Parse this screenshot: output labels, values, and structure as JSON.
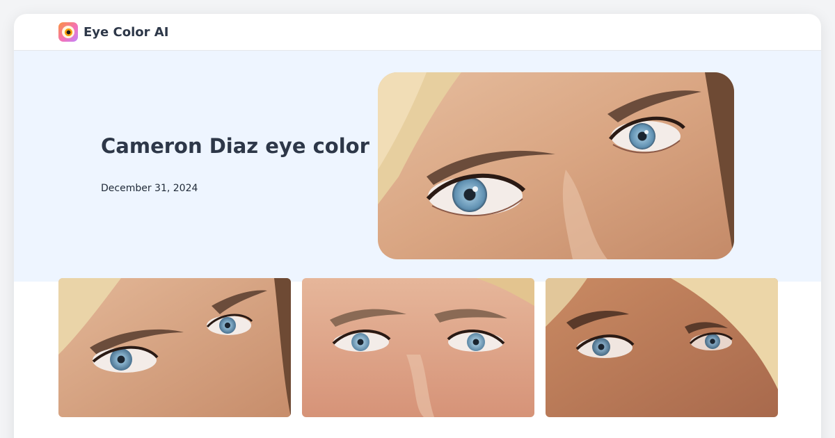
{
  "header": {
    "brand_name": "Eye Color AI",
    "logo_icon": "eye-icon"
  },
  "hero": {
    "title": "Cameron Diaz eye color",
    "date": "December 31, 2024",
    "photo_description": "close-up of blue eyes"
  },
  "gallery": {
    "items": [
      {
        "name": "eyes-photo-1"
      },
      {
        "name": "eyes-photo-2"
      },
      {
        "name": "eyes-photo-3"
      }
    ]
  },
  "colors": {
    "hero_background": "#eef5ff",
    "title_text": "#2d3748",
    "iris_blue": "#6b9ab8",
    "skin": "#d9a582",
    "hair": "#e7cf9f"
  }
}
